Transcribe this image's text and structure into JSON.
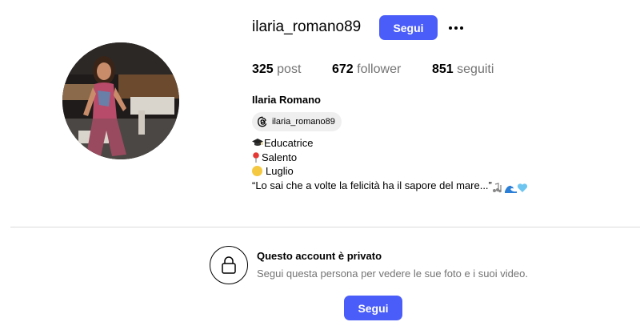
{
  "profile": {
    "username": "ilaria_romano89",
    "follow_label": "Segui",
    "more_icon": "more-horizontal-icon",
    "full_name": "Ilaria Romano",
    "threads_handle": "ilaria_romano89",
    "threads_icon": "threads-icon"
  },
  "stats": {
    "posts_count": "325",
    "posts_label": "post",
    "followers_count": "672",
    "followers_label": "follower",
    "following_count": "851",
    "following_label": "seguiti"
  },
  "bio": {
    "line1": "Educatrice",
    "line2": "Salento",
    "line3": "Luglio",
    "line4": "“Lo sai che a volte la felicità ha il sapore del mare...”"
  },
  "private_notice": {
    "title": "Questo account è privato",
    "subtitle": "Segui questa persona per vedere le sue foto e i suoi video.",
    "follow_label": "Segui",
    "lock_icon": "lock-icon"
  },
  "colors": {
    "accent": "#4a5df9",
    "secondary_text": "#737373",
    "divider": "#dbdbdb",
    "chip_bg": "#efefef"
  }
}
